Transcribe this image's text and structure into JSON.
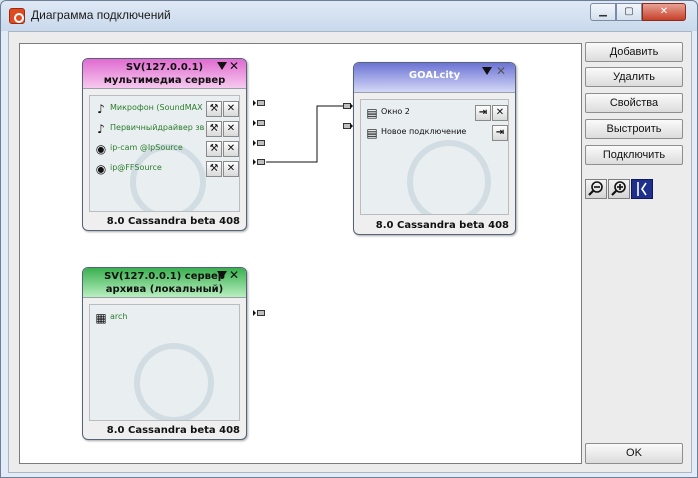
{
  "window": {
    "title": "Диаграмма подключений"
  },
  "buttons": {
    "add": "Добавить",
    "remove": "Удалить",
    "properties": "Свойства",
    "arrange": "Выстроить",
    "connect": "Подключить",
    "ok": "OK"
  },
  "tools": [
    {
      "icon": "zoom-out-icon"
    },
    {
      "icon": "zoom-in-icon"
    },
    {
      "icon": "connector-icon",
      "active": true
    }
  ],
  "nodes": {
    "media": {
      "title_line1": "SV(127.0.0.1)",
      "title_line2": "мультимедиа сервер",
      "footer": "8.0 Cassandra beta 408",
      "color": "#e06bd0",
      "rows": [
        {
          "icon": "music-note-icon",
          "label": "Микрофон (SoundMAX"
        },
        {
          "icon": "music-note-icon",
          "label": "Первичныйдрайвер зв"
        },
        {
          "icon": "camera-icon",
          "label": "ip-cam @IpSource"
        },
        {
          "icon": "camera-icon",
          "label": "ip@FFSource"
        }
      ]
    },
    "goal": {
      "title": "GOALcity",
      "footer": "8.0 Cassandra beta 408",
      "color": "#6c74d4",
      "rows": [
        {
          "icon": "window-icon",
          "label": "Окно 2"
        },
        {
          "icon": "window-icon",
          "label": "Новое подключение"
        }
      ]
    },
    "archive": {
      "title_line1": "SV(127.0.0.1) сервер",
      "title_line2": "архива (локальный)",
      "footer": "8.0 Cassandra beta 408",
      "color": "#39b04e",
      "rows": [
        {
          "icon": "archive-icon",
          "label": "arch"
        }
      ]
    }
  }
}
